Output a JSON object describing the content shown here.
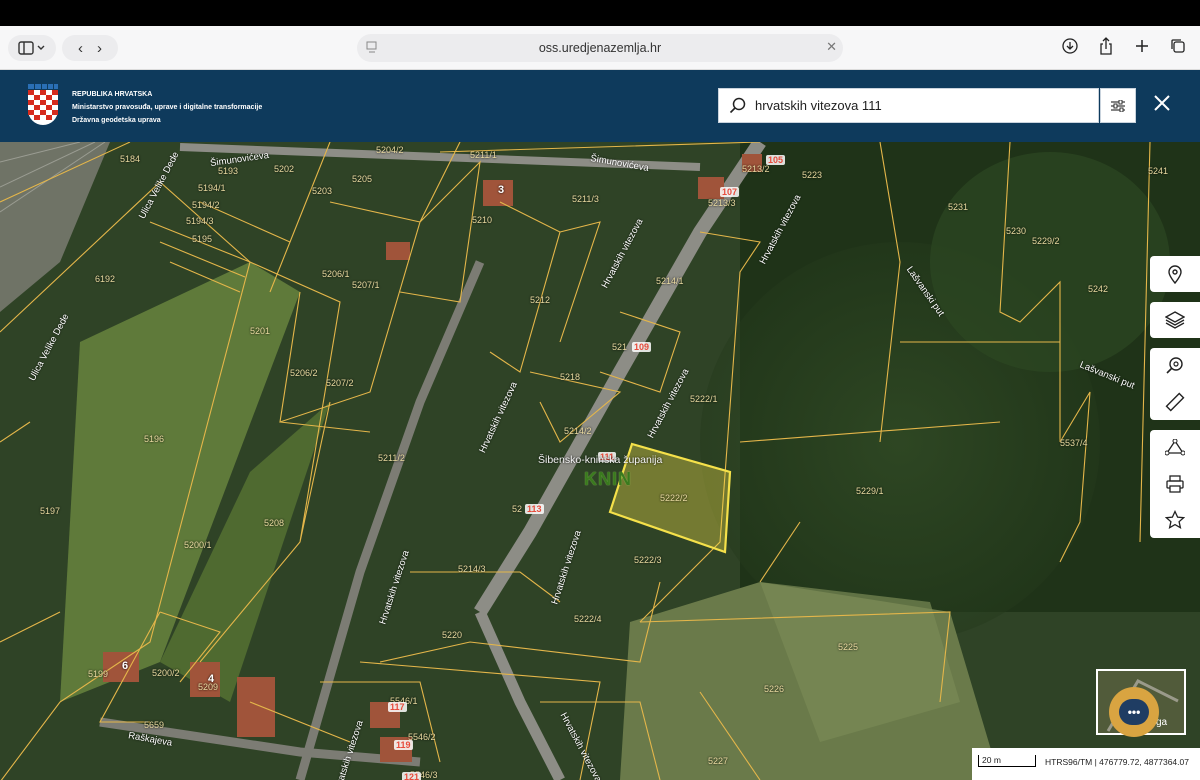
{
  "browser": {
    "url": "oss.uredjenazemlja.hr"
  },
  "header": {
    "brand_line1": "REPUBLIKA HRVATSKA",
    "brand_line2": "Ministarstvo pravosuđa, uprave i digitalne transformacije",
    "brand_line3": "Državna geodetska uprava",
    "search_value": "hrvatskih vitezova 111"
  },
  "map": {
    "parcels": [
      {
        "id": "p5184",
        "text": "5184"
      },
      {
        "id": "p5193",
        "text": "5193"
      },
      {
        "id": "p5202",
        "text": "5202"
      },
      {
        "id": "p5194_1",
        "text": "5194/1"
      },
      {
        "id": "p5194_2",
        "text": "5194/2"
      },
      {
        "id": "p5194_3",
        "text": "5194/3"
      },
      {
        "id": "p5195",
        "text": "5195"
      },
      {
        "id": "p5203",
        "text": "5203"
      },
      {
        "id": "p5205",
        "text": "5205"
      },
      {
        "id": "p5204_2",
        "text": "5204/2"
      },
      {
        "id": "p5211_1",
        "text": "5211/1"
      },
      {
        "id": "p5210",
        "text": "5210"
      },
      {
        "id": "p5211_3",
        "text": "5211/3"
      },
      {
        "id": "p5213_2",
        "text": "5213/2"
      },
      {
        "id": "p5213_3",
        "text": "5213/3"
      },
      {
        "id": "p5223",
        "text": "5223"
      },
      {
        "id": "p5231",
        "text": "5231"
      },
      {
        "id": "p5230",
        "text": "5230"
      },
      {
        "id": "p5229_2",
        "text": "5229/2"
      },
      {
        "id": "p5241",
        "text": "5241"
      },
      {
        "id": "p6192",
        "text": "6192"
      },
      {
        "id": "p5206_1",
        "text": "5206/1"
      },
      {
        "id": "p5207_1",
        "text": "5207/1"
      },
      {
        "id": "p5212",
        "text": "5212"
      },
      {
        "id": "p5214_1",
        "text": "5214/1"
      },
      {
        "id": "p5242",
        "text": "5242"
      },
      {
        "id": "p5201",
        "text": "5201"
      },
      {
        "id": "p5206_2",
        "text": "5206/2"
      },
      {
        "id": "p5207_2",
        "text": "5207/2"
      },
      {
        "id": "p5218",
        "text": "5218"
      },
      {
        "id": "p5217",
        "text": "521"
      },
      {
        "id": "p5222_1",
        "text": "5222/1"
      },
      {
        "id": "p5214_2",
        "text": "5214/2"
      },
      {
        "id": "p5196",
        "text": "5196"
      },
      {
        "id": "p5211_2",
        "text": "5211/2"
      },
      {
        "id": "p5537_4",
        "text": "5537/4"
      },
      {
        "id": "p5222_2",
        "text": "5222/2"
      },
      {
        "id": "p5229_1",
        "text": "5229/1"
      },
      {
        "id": "p5197",
        "text": "5197"
      },
      {
        "id": "p5208",
        "text": "5208"
      },
      {
        "id": "p5200_1",
        "text": "5200/1"
      },
      {
        "id": "p5213",
        "text": "52"
      },
      {
        "id": "p5222_3",
        "text": "5222/3"
      },
      {
        "id": "p5214_3",
        "text": "5214/3"
      },
      {
        "id": "p5222_4",
        "text": "5222/4"
      },
      {
        "id": "p5220",
        "text": "5220"
      },
      {
        "id": "p5225",
        "text": "5225"
      },
      {
        "id": "p5199",
        "text": "5199"
      },
      {
        "id": "p5200_2",
        "text": "5200/2"
      },
      {
        "id": "p5209",
        "text": "5209"
      },
      {
        "id": "p5226",
        "text": "5226"
      },
      {
        "id": "p5546_1",
        "text": "5546/1"
      },
      {
        "id": "p5659",
        "text": "5659"
      },
      {
        "id": "p5546_2",
        "text": "5546/2"
      },
      {
        "id": "p5227",
        "text": "5227"
      },
      {
        "id": "p5546_3",
        "text": "5546/3"
      }
    ],
    "streets": [
      {
        "id": "s1",
        "text": "Šimunovićeva"
      },
      {
        "id": "s2",
        "text": "Šimunovićeva"
      },
      {
        "id": "s3",
        "text": "Ulica Velike Dede"
      },
      {
        "id": "s4",
        "text": "Ulica Velike Dede"
      },
      {
        "id": "s5",
        "text": "Hrvatskih vitezova"
      },
      {
        "id": "s6",
        "text": "Hrvatskih vitezova"
      },
      {
        "id": "s7",
        "text": "Lašvanski put"
      },
      {
        "id": "s8",
        "text": "Lašvanski put"
      },
      {
        "id": "s9",
        "text": "Hrvatskih vitezova"
      },
      {
        "id": "s10",
        "text": "Hrvatskih vitezova"
      },
      {
        "id": "s11",
        "text": "Hrvatskih vitezova"
      },
      {
        "id": "s12",
        "text": "Hrvatskih vitezova"
      },
      {
        "id": "s13",
        "text": "Raškajeva"
      },
      {
        "id": "s14",
        "text": "Hrvatskih vitezova"
      },
      {
        "id": "s15",
        "text": "Hrvatskih vitezova"
      }
    ],
    "house_numbers": [
      {
        "id": "h105",
        "text": "105"
      },
      {
        "id": "h107",
        "text": "107"
      },
      {
        "id": "h3",
        "text": "3"
      },
      {
        "id": "h109",
        "text": "109"
      },
      {
        "id": "h111",
        "text": "111"
      },
      {
        "id": "h113",
        "text": "113"
      },
      {
        "id": "h6",
        "text": "6"
      },
      {
        "id": "h4",
        "text": "4"
      },
      {
        "id": "h117",
        "text": "117"
      },
      {
        "id": "h119",
        "text": "119"
      },
      {
        "id": "h121",
        "text": "121"
      }
    ],
    "county_label": "Šibensko-kninska županija",
    "town_label": "KNIN",
    "minimap_label": "ga",
    "scale_label": "20 m",
    "coords_text": "HTRS96/TM | 476779.72, 4877364.07",
    "highlight_color": "#f5e14a"
  },
  "tools": [
    {
      "name": "location-pin-icon"
    },
    {
      "name": "layers-icon"
    },
    {
      "name": "search-location-icon"
    },
    {
      "name": "ruler-icon"
    },
    {
      "name": "polygon-tool-icon"
    },
    {
      "name": "print-icon"
    },
    {
      "name": "star-icon"
    }
  ]
}
